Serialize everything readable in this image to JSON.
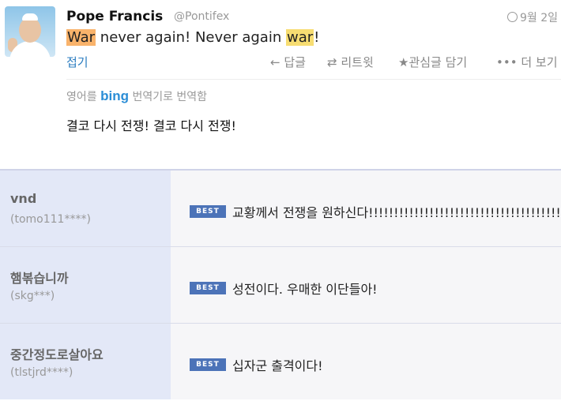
{
  "tweet": {
    "author_name": "Pope Francis",
    "handle": "@Pontifex",
    "date": "9월 2일",
    "text_hl1": "War",
    "text_mid": " never again! Never again ",
    "text_hl2": "war",
    "text_end": "!",
    "collapse_label": "접기",
    "actions": {
      "reply": "답글",
      "retweet": "리트윗",
      "favorite": "관심글 담기",
      "more": "더 보기"
    },
    "translate_prefix": "영어를",
    "translate_brand": "bing",
    "translate_suffix": "번역기로 번역함",
    "translated_text": "결코 다시 전쟁! 결코 다시 전쟁!"
  },
  "comments": [
    {
      "name": "vnd",
      "id": "(tomo111****)",
      "badge": "BEST",
      "text": "교황께서 전쟁을 원하신다!!!!!!!!!!!!!!!!!!!!!!!!!!!!!!!!!!!!!!!!!!"
    },
    {
      "name": "햄볶습니까",
      "id": "(skg***)",
      "badge": "BEST",
      "text": "성전이다. 우매한 이단들아!"
    },
    {
      "name": "중간정도로살아요",
      "id": "(tlstjrd****)",
      "badge": "BEST",
      "text": "십자군 출격이다!"
    }
  ]
}
